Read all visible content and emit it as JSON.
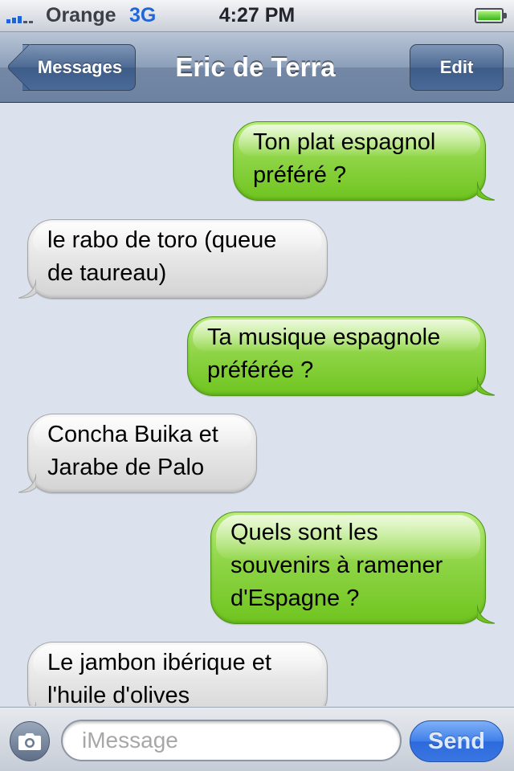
{
  "status_bar": {
    "carrier": "Orange",
    "network": "3G",
    "time": "4:27 PM",
    "signal_bars_active": 3,
    "battery_level": 1.0
  },
  "nav_bar": {
    "back_label": "Messages",
    "title": "Eric de Terra",
    "edit_label": "Edit"
  },
  "messages": [
    {
      "direction": "sent",
      "lines": [
        "Ton plat espagnol",
        "préféré ?"
      ]
    },
    {
      "direction": "received",
      "lines": [
        "le rabo de toro (queue",
        "de taureau)"
      ]
    },
    {
      "direction": "sent",
      "lines": [
        "Ta musique espagnole",
        "préférée ?"
      ]
    },
    {
      "direction": "received",
      "lines": [
        "Concha Buika et",
        "Jarabe de Palo"
      ]
    },
    {
      "direction": "sent",
      "lines": [
        "Quels sont les",
        "souvenirs à ramener",
        "d'Espagne ?"
      ]
    },
    {
      "direction": "received",
      "lines": [
        "Le jambon ibérique et",
        "l'huile d'olives"
      ]
    }
  ],
  "input_bar": {
    "placeholder": "iMessage",
    "send_label": "Send"
  },
  "colors": {
    "sent_bubble": "#8fd547",
    "received_bubble": "#e6e6e6",
    "background": "#dbe2ed",
    "accent": "#1f67d8"
  }
}
